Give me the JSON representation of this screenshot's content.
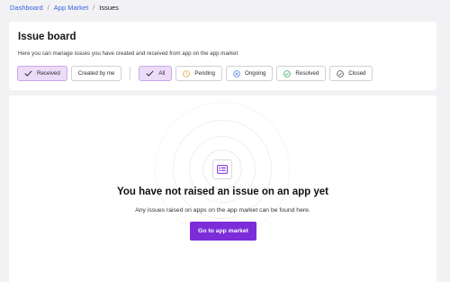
{
  "breadcrumb": {
    "items": [
      "Dashboard",
      "App Market"
    ],
    "current": "Issues",
    "separator": "/"
  },
  "header": {
    "title": "Issue board",
    "description": "Here you can manage issues you have created and received from app on the app market"
  },
  "filters": {
    "direction": [
      {
        "label": "Received",
        "active": true,
        "icon": "check-icon"
      },
      {
        "label": "Created by me",
        "active": false
      }
    ],
    "status": [
      {
        "label": "All",
        "active": true,
        "icon": "check-icon"
      },
      {
        "label": "Pending",
        "active": false,
        "icon": "pending-icon",
        "color": "#e8a33d"
      },
      {
        "label": "Ongoing",
        "active": false,
        "icon": "ongoing-icon",
        "color": "#4a7be8"
      },
      {
        "label": "Resolved",
        "active": false,
        "icon": "resolved-icon",
        "color": "#3aaa5c"
      },
      {
        "label": "Closed",
        "active": false,
        "icon": "closed-icon",
        "color": "#555555"
      }
    ]
  },
  "empty_state": {
    "icon": "issue-list-icon",
    "title": "You have not raised an issue on an app yet",
    "subtitle": "Any issues raised on apps on the app market can be found here.",
    "button_label": "Go to app market"
  },
  "colors": {
    "accent": "#7c2cd8",
    "active_chip_bg": "#ecdcf9",
    "link": "#3a63e0"
  }
}
